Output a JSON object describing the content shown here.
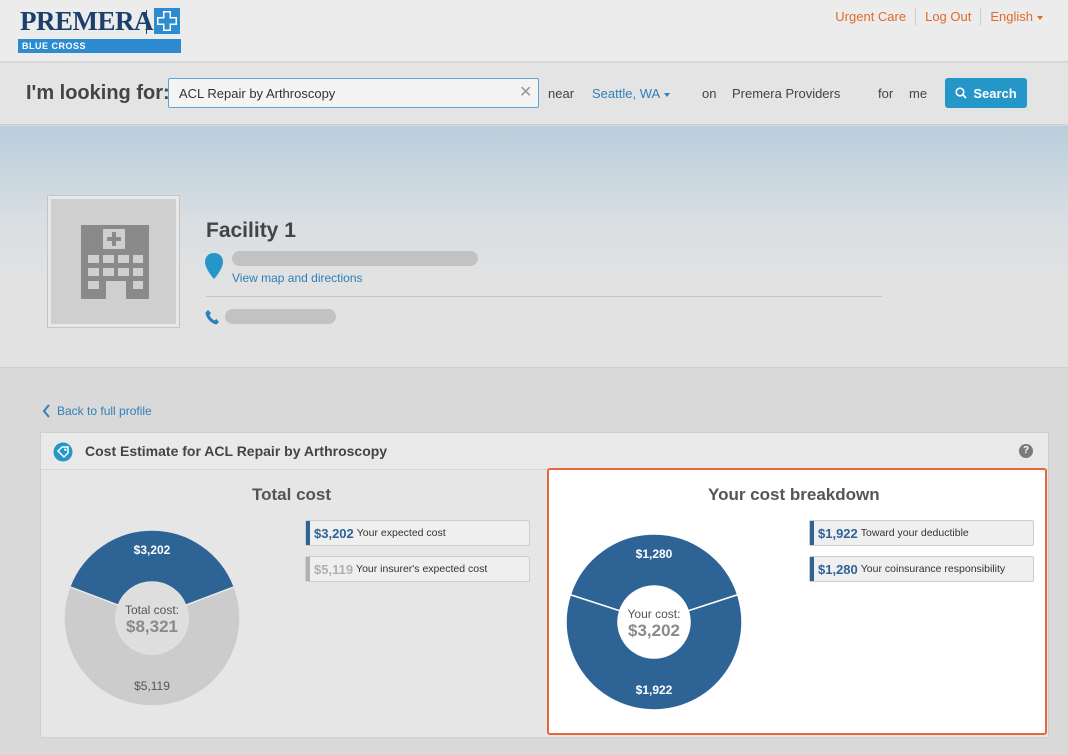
{
  "brand": {
    "name": "PREMERA",
    "sub": "BLUE CROSS",
    "color": "#1d3f6e",
    "band_color": "#2d8bd0"
  },
  "top_links": [
    {
      "label": "Urgent Care"
    },
    {
      "label": "Log Out"
    },
    {
      "label": "English"
    }
  ],
  "search": {
    "label": "I'm looking for:",
    "value": "ACL Repair by Arthroscopy",
    "near_label": "near",
    "location": "Seattle, WA",
    "on_label": "on",
    "network": "Premera Providers",
    "for_label": "for",
    "who": "me",
    "button": "Search"
  },
  "facility": {
    "name": "Facility 1",
    "map_link": "View map and directions"
  },
  "back_link": "Back to full profile",
  "estimate": {
    "title": "Cost Estimate for ACL Repair by Arthroscopy",
    "help": "?",
    "total": {
      "title": "Total cost",
      "center_label": "Total cost:",
      "center_value": "$8,321",
      "legend": [
        {
          "amount": "$3,202",
          "label": "Your expected cost",
          "color": "#2e6396"
        },
        {
          "amount": "$5,119",
          "label": "Your insurer's expected cost",
          "color": "#b0b0b0"
        }
      ]
    },
    "breakdown": {
      "title": "Your cost breakdown",
      "center_label": "Your cost:",
      "center_value": "$3,202",
      "legend": [
        {
          "amount": "$1,922",
          "label": "Toward your deductible",
          "color": "#2e6396"
        },
        {
          "amount": "$1,280",
          "label": "Your coinsurance responsibility",
          "color": "#2e6396"
        }
      ]
    }
  },
  "chart_data": [
    {
      "type": "pie",
      "title": "Total cost",
      "categories": [
        "Your expected cost",
        "Your insurer's expected cost"
      ],
      "values": [
        3202,
        5119
      ],
      "data_labels": [
        "$3,202",
        "$5,119"
      ],
      "colors": [
        "#2e6396",
        "#cccccc"
      ],
      "center_text": [
        "Total cost:",
        "$8,321"
      ]
    },
    {
      "type": "pie",
      "title": "Your cost breakdown",
      "categories": [
        "Your coinsurance responsibility",
        "Toward your deductible"
      ],
      "values": [
        1280,
        1922
      ],
      "data_labels": [
        "$1,280",
        "$1,922"
      ],
      "colors": [
        "#2e6396",
        "#2e6396"
      ],
      "center_text": [
        "Your cost:",
        "$3,202"
      ]
    }
  ]
}
